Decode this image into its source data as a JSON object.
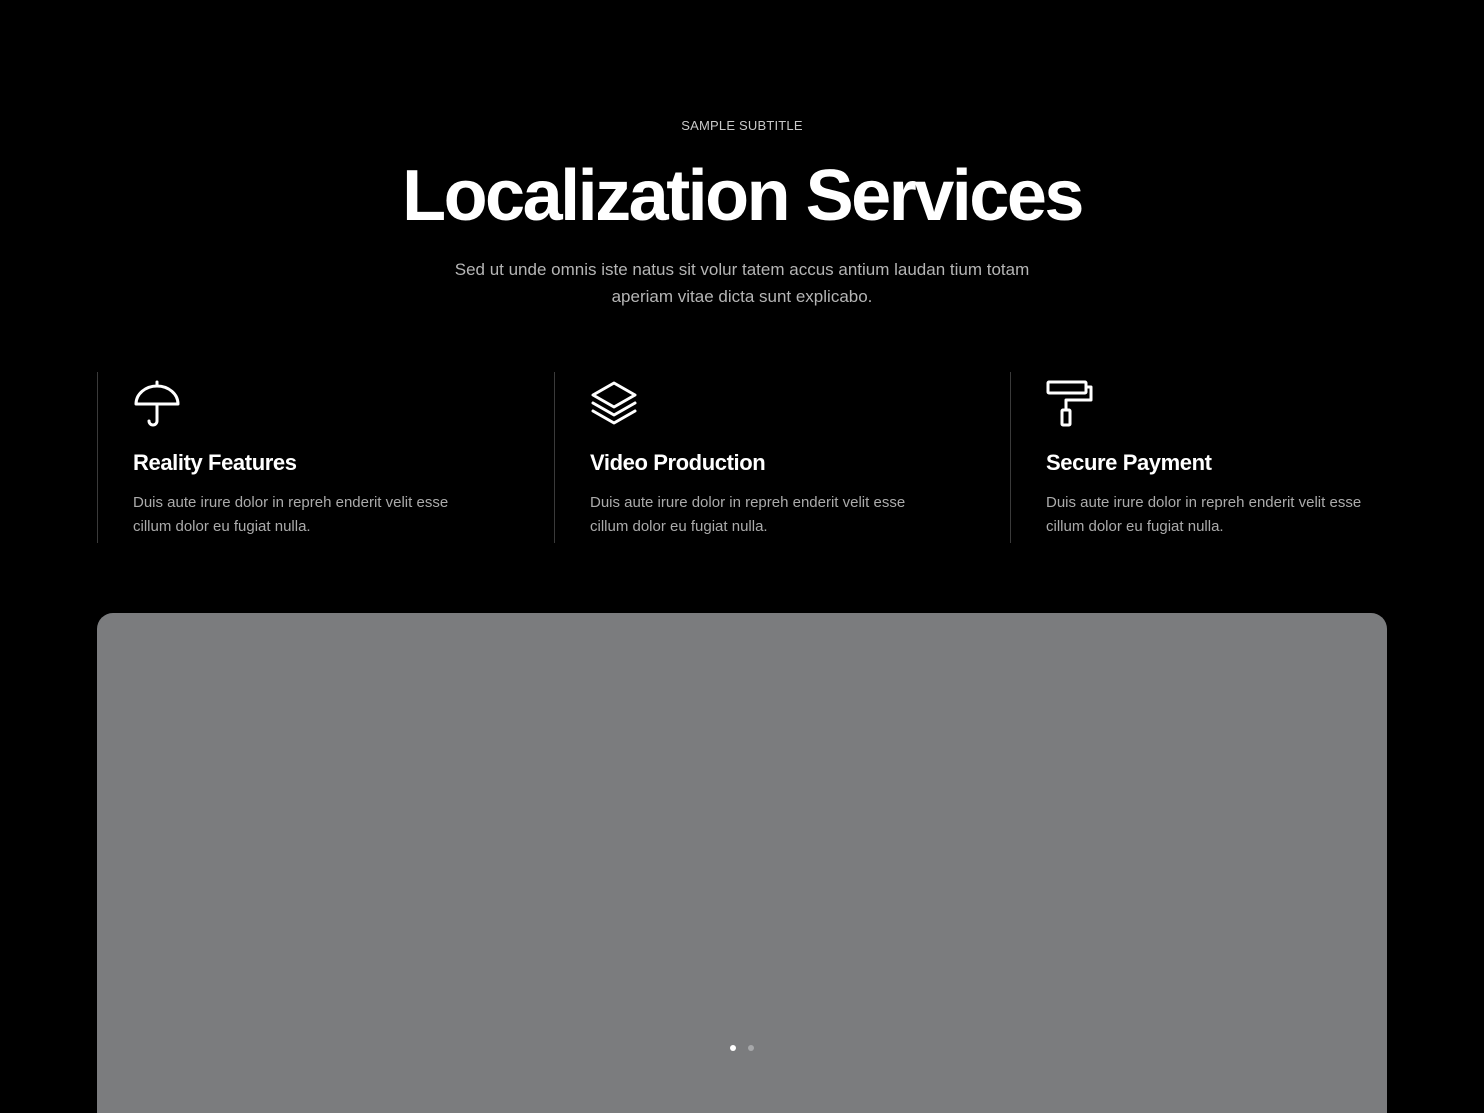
{
  "header": {
    "subtitle": "SAMPLE SUBTITLE",
    "title": "Localization Services",
    "lead": "Sed ut unde omnis iste natus sit volur tatem accus antium laudan tium totam aperiam vitae dicta sunt explicabo."
  },
  "features": [
    {
      "icon": "umbrella-icon",
      "title": "Reality Features",
      "text": "Duis aute irure dolor in repreh enderit velit esse cillum dolor eu fugiat nulla."
    },
    {
      "icon": "layers-icon",
      "title": "Video Production",
      "text": "Duis aute irure dolor in repreh enderit velit esse cillum dolor eu fugiat nulla."
    },
    {
      "icon": "paint-roller-icon",
      "title": "Secure Payment",
      "text": "Duis aute irure dolor in repreh enderit velit esse cillum dolor eu fugiat nulla."
    }
  ],
  "slider": {
    "slide_count": 2,
    "active_index": 0
  },
  "colors": {
    "background": "#000000",
    "text_primary": "#ffffff",
    "text_muted": "#ababab",
    "media_placeholder": "#7b7c7e",
    "divider": "#3a3a3a"
  }
}
